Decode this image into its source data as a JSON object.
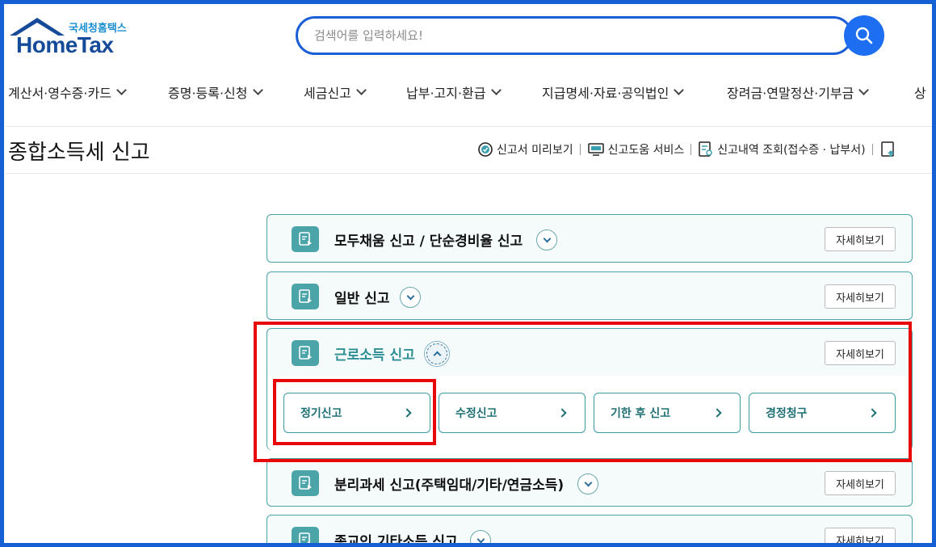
{
  "header": {
    "logo_sub": "국세청홈택스",
    "logo_main": "HomeTax",
    "search_placeholder": "검색어를 입력하세요!"
  },
  "nav": [
    {
      "label": "계산서·영수증·카드"
    },
    {
      "label": "증명·등록·신청"
    },
    {
      "label": "세금신고"
    },
    {
      "label": "납부·고지·환급"
    },
    {
      "label": "지급명세·자료·공익법인"
    },
    {
      "label": "장려금·연말정산·기부금"
    },
    {
      "label": "상"
    }
  ],
  "page": {
    "title": "종합소득세 신고",
    "tools": [
      {
        "label": "신고서 미리보기",
        "icon": "preview-check-icon"
      },
      {
        "label": "신고도움 서비스",
        "icon": "monitor-help-icon"
      },
      {
        "label": "신고내역 조회(접수증 · 납부서)",
        "icon": "document-search-icon"
      }
    ]
  },
  "accordion": [
    {
      "title": "모두채움 신고 / 단순경비율 신고",
      "detail": "자세히보기",
      "open": false
    },
    {
      "title": "일반 신고",
      "detail": "자세히보기",
      "open": false
    },
    {
      "title": "근로소득 신고",
      "detail": "자세히보기",
      "open": true,
      "sub": [
        {
          "label": "정기신고"
        },
        {
          "label": "수정신고"
        },
        {
          "label": "기한 후 신고"
        },
        {
          "label": "경정청구"
        }
      ]
    },
    {
      "title": "분리과세 신고(주택임대/기타/연금소득)",
      "detail": "자세히보기",
      "open": false
    },
    {
      "title": "종교인 기타소득 신고",
      "detail": "자세히보기",
      "open": false
    }
  ],
  "colors": {
    "brand_blue": "#1d6ef0",
    "accent_teal": "#4ba4a8",
    "highlight_red": "#e80808"
  }
}
